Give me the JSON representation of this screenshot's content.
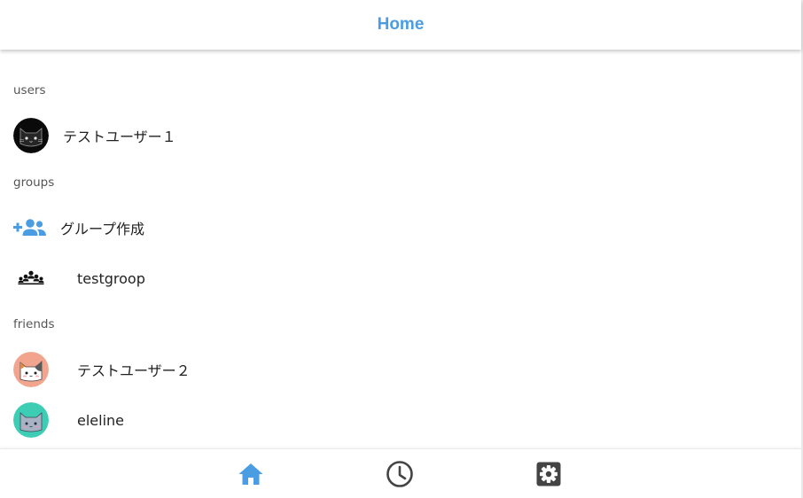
{
  "header": {
    "title": "Home"
  },
  "sections": {
    "users": {
      "label": "users",
      "items": [
        {
          "name": "テストユーザー１",
          "avatar": "black-cat-icon"
        }
      ]
    },
    "groups": {
      "label": "groups",
      "create_label": "グループ作成",
      "create_icon": "group-add-icon",
      "items": [
        {
          "name": "testgroop",
          "icon": "group-icon"
        }
      ]
    },
    "friends": {
      "label": "friends",
      "items": [
        {
          "name": "テストユーザー２",
          "avatar": "calico-cat-icon"
        },
        {
          "name": "eleline",
          "avatar": "gray-cat-icon"
        }
      ]
    }
  },
  "tabbar": {
    "tabs": [
      {
        "name": "home",
        "icon": "home-icon",
        "active": true
      },
      {
        "name": "history",
        "icon": "clock-icon",
        "active": false
      },
      {
        "name": "settings",
        "icon": "settings-icon",
        "active": false
      }
    ]
  },
  "colors": {
    "accent": "#4a9de3",
    "icon_dark": "#444444",
    "calico_bg": "#f2a58e",
    "gray_cat_bg": "#3ccdb4"
  }
}
